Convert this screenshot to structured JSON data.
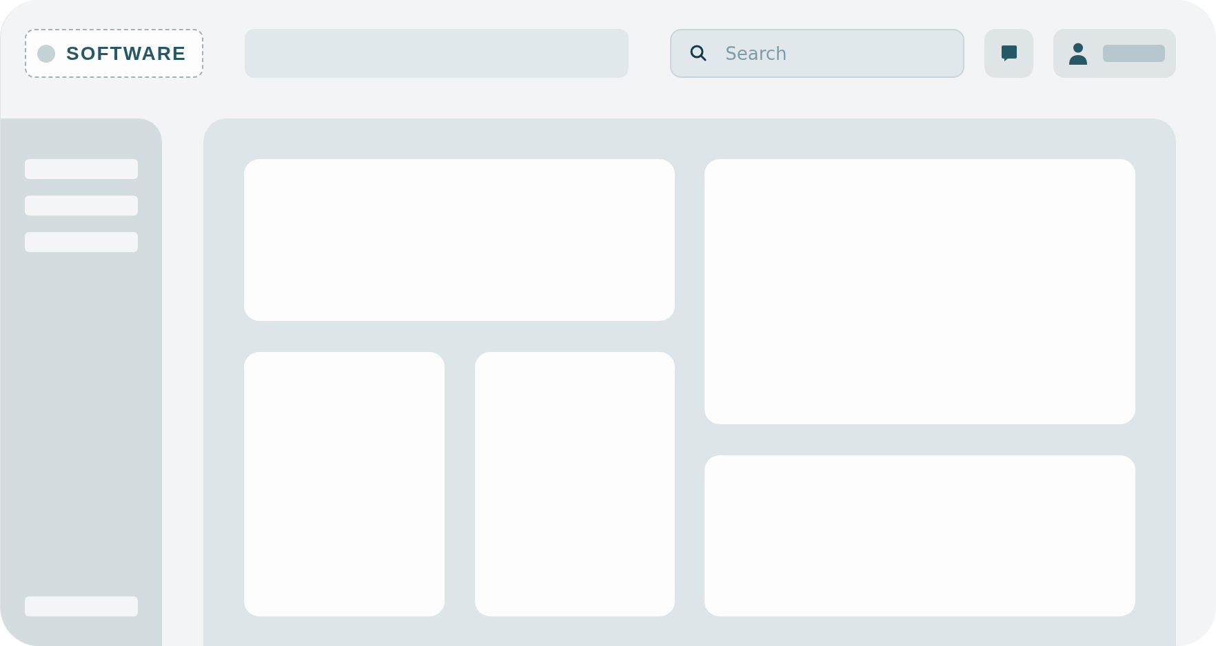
{
  "header": {
    "logo": {
      "text": "SOFTWARE"
    },
    "nav": {
      "kind": "placeholder"
    },
    "search": {
      "placeholder": "Search"
    },
    "actions": [
      {
        "kind": "chat"
      },
      {
        "kind": "profile"
      }
    ]
  },
  "sidebar": {
    "items": [
      {
        "kind": "placeholder"
      },
      {
        "kind": "placeholder"
      },
      {
        "kind": "placeholder"
      }
    ],
    "footer_items": [
      {
        "kind": "placeholder"
      }
    ]
  },
  "content": {
    "left": [
      {
        "kind": "wide"
      },
      {
        "kind": "pair"
      }
    ],
    "right": [
      {
        "kind": "tall"
      },
      {
        "kind": "short"
      }
    ]
  }
}
